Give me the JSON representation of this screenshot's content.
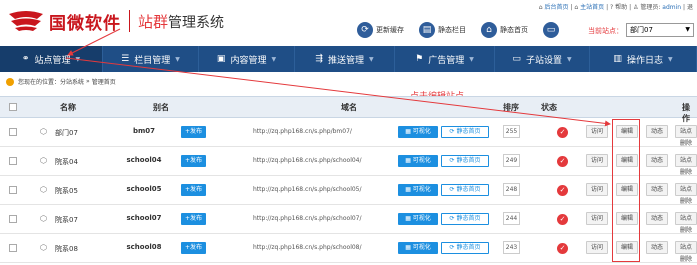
{
  "header": {
    "brand": "国微软件",
    "title_highlight": "站群",
    "title_rest": "管理系统",
    "top_links": {
      "admin_home": "后台首页",
      "site_home": "主站首页",
      "help": "帮助",
      "manager_label": "管理员:",
      "manager": "admin",
      "sep": "|",
      "logout_initial": "退"
    },
    "tools": [
      "更新缓存",
      "静态栏目",
      "静态首页"
    ],
    "current_site_label": "当前站点：",
    "current_site_value": "部门07"
  },
  "nav": {
    "items": [
      {
        "icon": "sitemap-icon",
        "label": "站点管理",
        "active": true
      },
      {
        "icon": "list-icon",
        "label": "栏目管理",
        "active": false
      },
      {
        "icon": "content-icon",
        "label": "内容管理",
        "active": false
      },
      {
        "icon": "push-icon",
        "label": "推送管理",
        "active": false
      },
      {
        "icon": "ad-icon",
        "label": "广告管理",
        "active": false
      },
      {
        "icon": "monitor-icon",
        "label": "子站设置",
        "active": false
      },
      {
        "icon": "log-icon",
        "label": "操作日志",
        "active": false
      }
    ]
  },
  "breadcrumb": {
    "prefix": "您现在的位置：",
    "path1": "分站系统",
    "arrow": "»",
    "path2": "管理首页"
  },
  "annotation": "点击编辑站点",
  "table": {
    "headers": {
      "name": "名称",
      "alias": "别名",
      "domain": "域名",
      "sort": "排序",
      "status": "状态",
      "ops": "操作"
    },
    "publish_label": "+发布",
    "visual_label": "可视化",
    "static_label": "静态首页",
    "visit_label": "访问",
    "edit_label": "编辑",
    "dynamic_label": "动态",
    "more_label": "站点",
    "delete_label": "删除",
    "rows": [
      {
        "name": "部门07",
        "alias": "bm07",
        "url": "http://zq.php168.cn/s.php/bm07/",
        "sort": "255"
      },
      {
        "name": "院系04",
        "alias": "school04",
        "url": "http://zq.php168.cn/s.php/school04/",
        "sort": "249"
      },
      {
        "name": "院系05",
        "alias": "school05",
        "url": "http://zq.php168.cn/s.php/school05/",
        "sort": "248"
      },
      {
        "name": "院系07",
        "alias": "school07",
        "url": "http://zq.php168.cn/s.php/school07/",
        "sort": "244"
      },
      {
        "name": "院系08",
        "alias": "school08",
        "url": "http://zq.php168.cn/s.php/school08/",
        "sort": "243"
      }
    ]
  },
  "colors": {
    "brand_red": "#c9161d",
    "nav_blue": "#1f4e86",
    "button_blue": "#1c8fe0",
    "annotation_red": "#e4393c"
  }
}
